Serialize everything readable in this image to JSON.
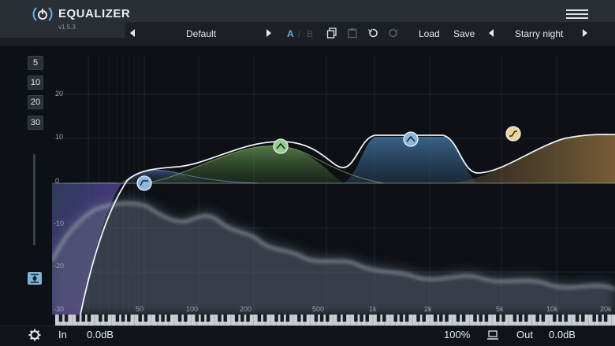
{
  "app": {
    "title": "EQUALIZER",
    "version": "v1.5.3"
  },
  "toolbar": {
    "preset_name": "Default",
    "ab_a": "A",
    "ab_sep": "/",
    "ab_b": "B",
    "load_label": "Load",
    "save_label": "Save",
    "style_name": "Starry night"
  },
  "range_buttons": [
    "5",
    "10",
    "20",
    "30"
  ],
  "db_labels": [
    "20",
    "10",
    "0",
    "-10",
    "-20",
    "-30"
  ],
  "freq_labels": [
    "50",
    "100",
    "200",
    "500",
    "1k",
    "2k",
    "5k",
    "10k",
    "20k"
  ],
  "bottom": {
    "in_label": "In",
    "in_gain": "0.0dB",
    "zoom": "100%",
    "out_label": "Out",
    "out_gain": "0.0dB"
  },
  "colors": {
    "accent": "#6fa8dc",
    "band_green": "#8fd08a",
    "band_blue": "#8ab8dc",
    "band_tan": "#e8d49a",
    "curve": "#e8ecf0"
  },
  "bands": [
    {
      "type": "high-pass",
      "freq": "50",
      "gain_db": 0
    },
    {
      "type": "bell",
      "freq": "300",
      "gain_db": 9
    },
    {
      "type": "bell",
      "freq": "1.5k",
      "gain_db": 11
    },
    {
      "type": "high-shelf",
      "freq": "6k",
      "gain_db": 11
    }
  ]
}
